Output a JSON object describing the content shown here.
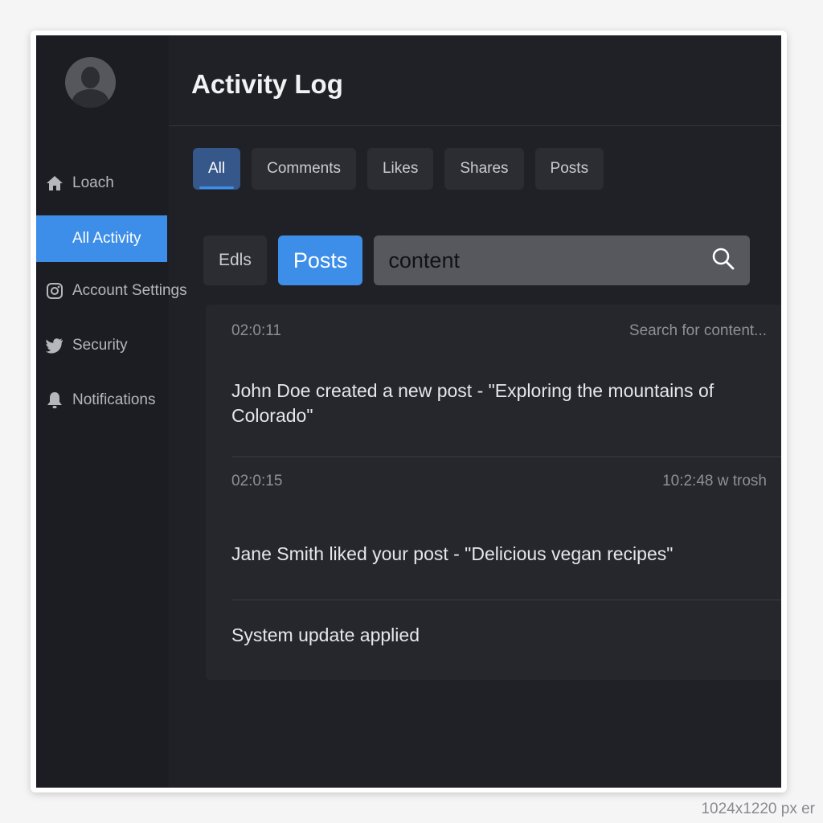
{
  "page": {
    "title": "Activity Log",
    "corner_note": "1024x1220 px er"
  },
  "sidebar": {
    "avatar_icon": "user-avatar-icon",
    "items": [
      {
        "label": "Loach",
        "icon": "home-icon",
        "active": false
      },
      {
        "label": "All Activity",
        "icon": "",
        "active": true
      },
      {
        "label": "Account Settings",
        "icon": "instagram-icon",
        "active": false
      },
      {
        "label": "Security",
        "icon": "twitter-bird-icon",
        "active": false
      },
      {
        "label": "Notifications",
        "icon": "bell-icon",
        "active": false
      }
    ]
  },
  "tabs": [
    {
      "label": "All",
      "active": true
    },
    {
      "label": "Comments",
      "active": false
    },
    {
      "label": "Likes",
      "active": false
    },
    {
      "label": "Shares",
      "active": false
    },
    {
      "label": "Posts",
      "active": false
    }
  ],
  "filters": {
    "chip_secondary": "Edls",
    "chip_primary": "Posts",
    "search_value": "content",
    "search_icon": "search-icon"
  },
  "activity": [
    {
      "time": "02:0:11",
      "meta": "Search for content...",
      "message": "John Doe created a new post - \"Exploring the mountains of Colorado\""
    },
    {
      "time": "02:0:15",
      "meta": "10:2:48 w trosh",
      "message": "Jane Smith liked your post - \"Delicious vegan recipes\""
    },
    {
      "time": "",
      "meta": "",
      "message": "System update applied"
    }
  ],
  "colors": {
    "accent": "#3d8ee8",
    "background": "#202126",
    "sidebar": "#1c1d22",
    "panel": "#26272c"
  }
}
